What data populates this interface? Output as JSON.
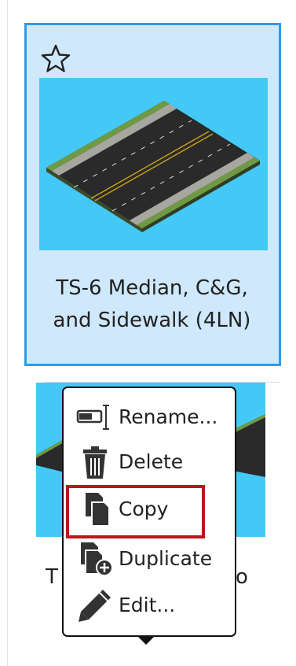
{
  "card1": {
    "title_line1": "TS-6 Median, C&G,",
    "title_line2": "and Sidewalk (4LN)",
    "thumb_bg": "#44c8f5",
    "favorite_icon": "star-outline-icon"
  },
  "card2": {
    "title_left": "T",
    "title_right": "o"
  },
  "context_menu": {
    "items": [
      {
        "label": "Rename...",
        "icon": "rename-icon"
      },
      {
        "label": "Delete",
        "icon": "trash-icon"
      },
      {
        "label": "Copy",
        "icon": "copy-icon"
      },
      {
        "label": "Duplicate",
        "icon": "duplicate-icon"
      },
      {
        "label": "Edit...",
        "icon": "pencil-icon"
      }
    ],
    "highlighted_item": "Copy",
    "highlight_color": "#c0151b"
  },
  "colors": {
    "selection_bg": "#cfe8fb",
    "selection_border": "#2f9be6"
  }
}
